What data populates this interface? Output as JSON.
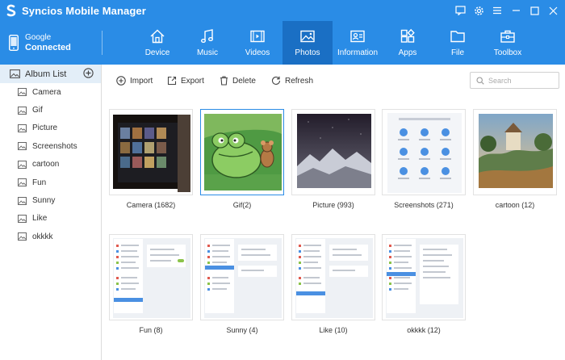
{
  "app": {
    "title": "Syncios Mobile Manager"
  },
  "window_controls": [
    "message-icon",
    "settings-icon",
    "menu-icon",
    "minimize-icon",
    "maximize-icon",
    "close-icon"
  ],
  "device": {
    "name": "Google",
    "status": "Connected"
  },
  "nav": {
    "active": "Photos",
    "tabs": [
      {
        "label": "Device",
        "icon": "home-icon"
      },
      {
        "label": "Music",
        "icon": "music-icon"
      },
      {
        "label": "Videos",
        "icon": "video-icon"
      },
      {
        "label": "Photos",
        "icon": "photo-icon"
      },
      {
        "label": "Information",
        "icon": "contact-card-icon"
      },
      {
        "label": "Apps",
        "icon": "apps-icon"
      },
      {
        "label": "File",
        "icon": "folder-icon"
      },
      {
        "label": "Toolbox",
        "icon": "toolbox-icon"
      }
    ]
  },
  "sidebar": {
    "header": "Album List",
    "items": [
      "Camera",
      "Gif",
      "Picture",
      "Screenshots",
      "cartoon",
      "Fun",
      "Sunny",
      "Like",
      "okkkk"
    ]
  },
  "toolbar": {
    "import": "Import",
    "export": "Export",
    "delete": "Delete",
    "refresh": "Refresh",
    "search_placeholder": "Search"
  },
  "albums": [
    {
      "label": "Camera (1682)",
      "selected": false
    },
    {
      "label": "Gif(2)",
      "selected": true
    },
    {
      "label": "Picture (993)",
      "selected": false
    },
    {
      "label": "Screenshots (271)",
      "selected": false
    },
    {
      "label": "cartoon (12)",
      "selected": false
    },
    {
      "label": "Fun (8)",
      "selected": false
    },
    {
      "label": "Sunny (4)",
      "selected": false
    },
    {
      "label": "Like (10)",
      "selected": false
    },
    {
      "label": "okkkk (12)",
      "selected": false
    }
  ],
  "colors": {
    "accent": "#2a8ce6",
    "active_tab": "#1a6fc4",
    "sidebar_header": "#e3eef8"
  }
}
